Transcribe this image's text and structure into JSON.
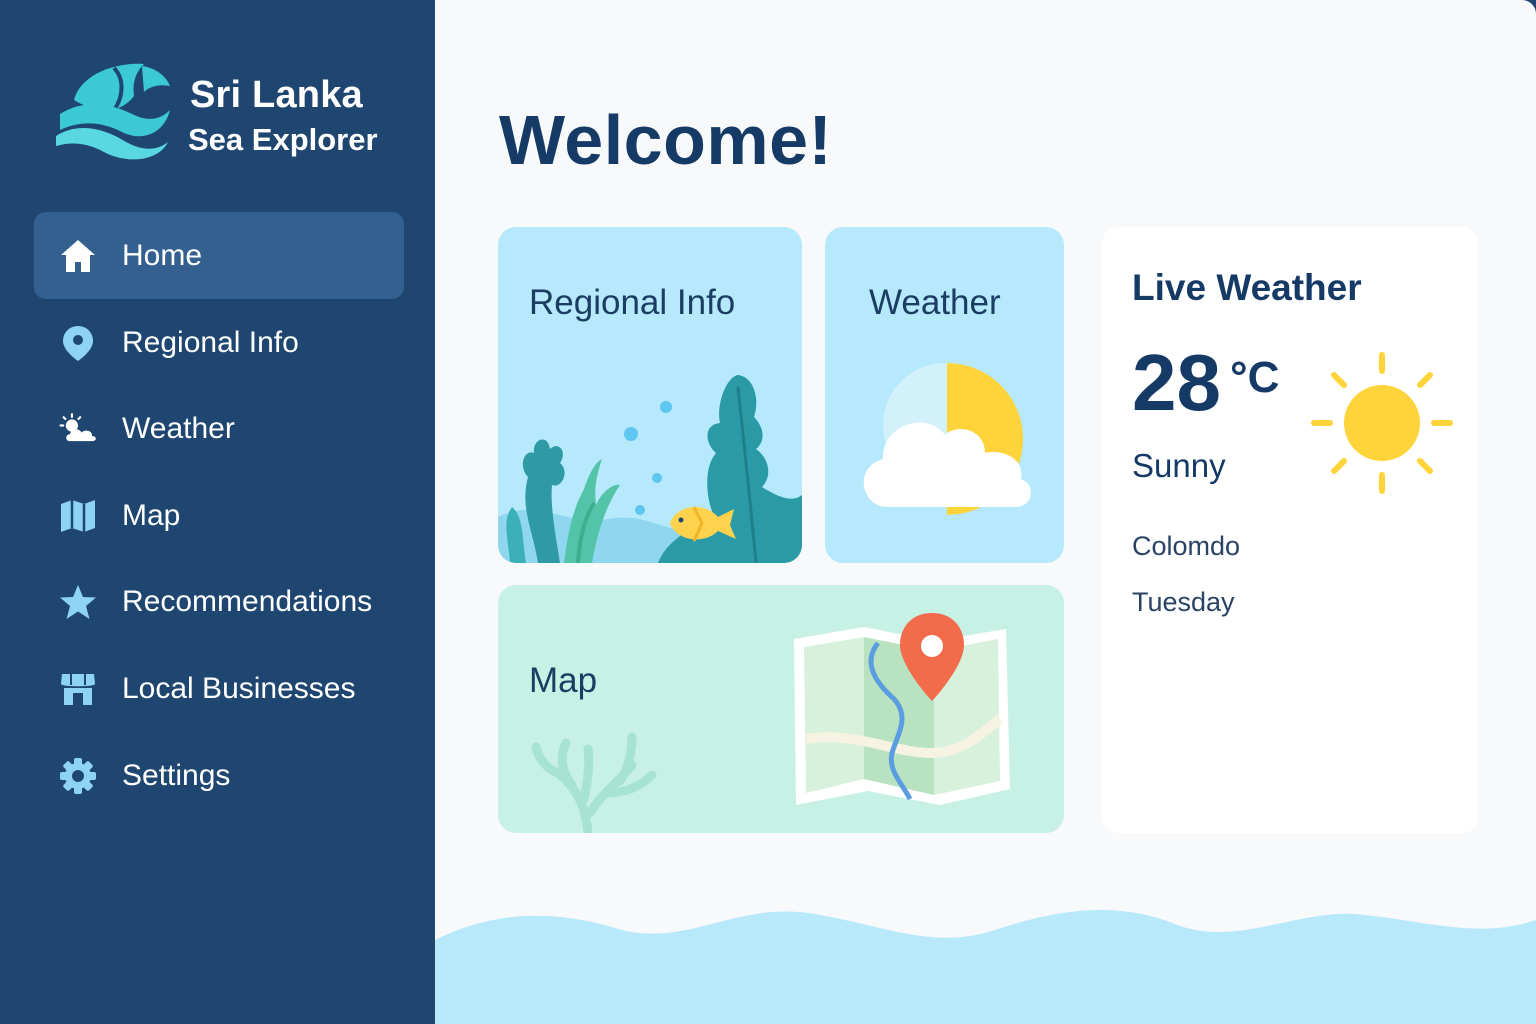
{
  "app": {
    "title": "Sri Lanka",
    "subtitle": "Sea Explorer"
  },
  "sidebar": {
    "active_index": 0,
    "items": [
      {
        "label": "Home",
        "icon": "home-icon"
      },
      {
        "label": "Regional Info",
        "icon": "map-pin-icon"
      },
      {
        "label": "Weather",
        "icon": "sun-cloud-icon"
      },
      {
        "label": "Map",
        "icon": "map-icon"
      },
      {
        "label": "Recommendations",
        "icon": "star-icon"
      },
      {
        "label": "Local Businesses",
        "icon": "storefront-icon"
      },
      {
        "label": "Settings",
        "icon": "gear-icon"
      }
    ]
  },
  "main": {
    "heading": "Welcome!",
    "cards": {
      "regional": {
        "title": "Regional Info"
      },
      "weather": {
        "title": "Weather"
      },
      "map": {
        "title": "Map"
      }
    },
    "live_weather": {
      "title": "Live Weather",
      "temperature": "28",
      "unit": "°C",
      "condition": "Sunny",
      "location": "Colomdo",
      "day": "Tuesday"
    }
  },
  "colors": {
    "sidebar_bg": "#1f4671",
    "active_item_bg": "#33608f",
    "heading_text": "#163a66",
    "card_blue": "#b5e9fb",
    "card_mint": "#c8f1e6",
    "sun_yellow": "#ffd43b",
    "pin_orange": "#f26b4a",
    "icon_light_blue": "#8fd3f4"
  }
}
